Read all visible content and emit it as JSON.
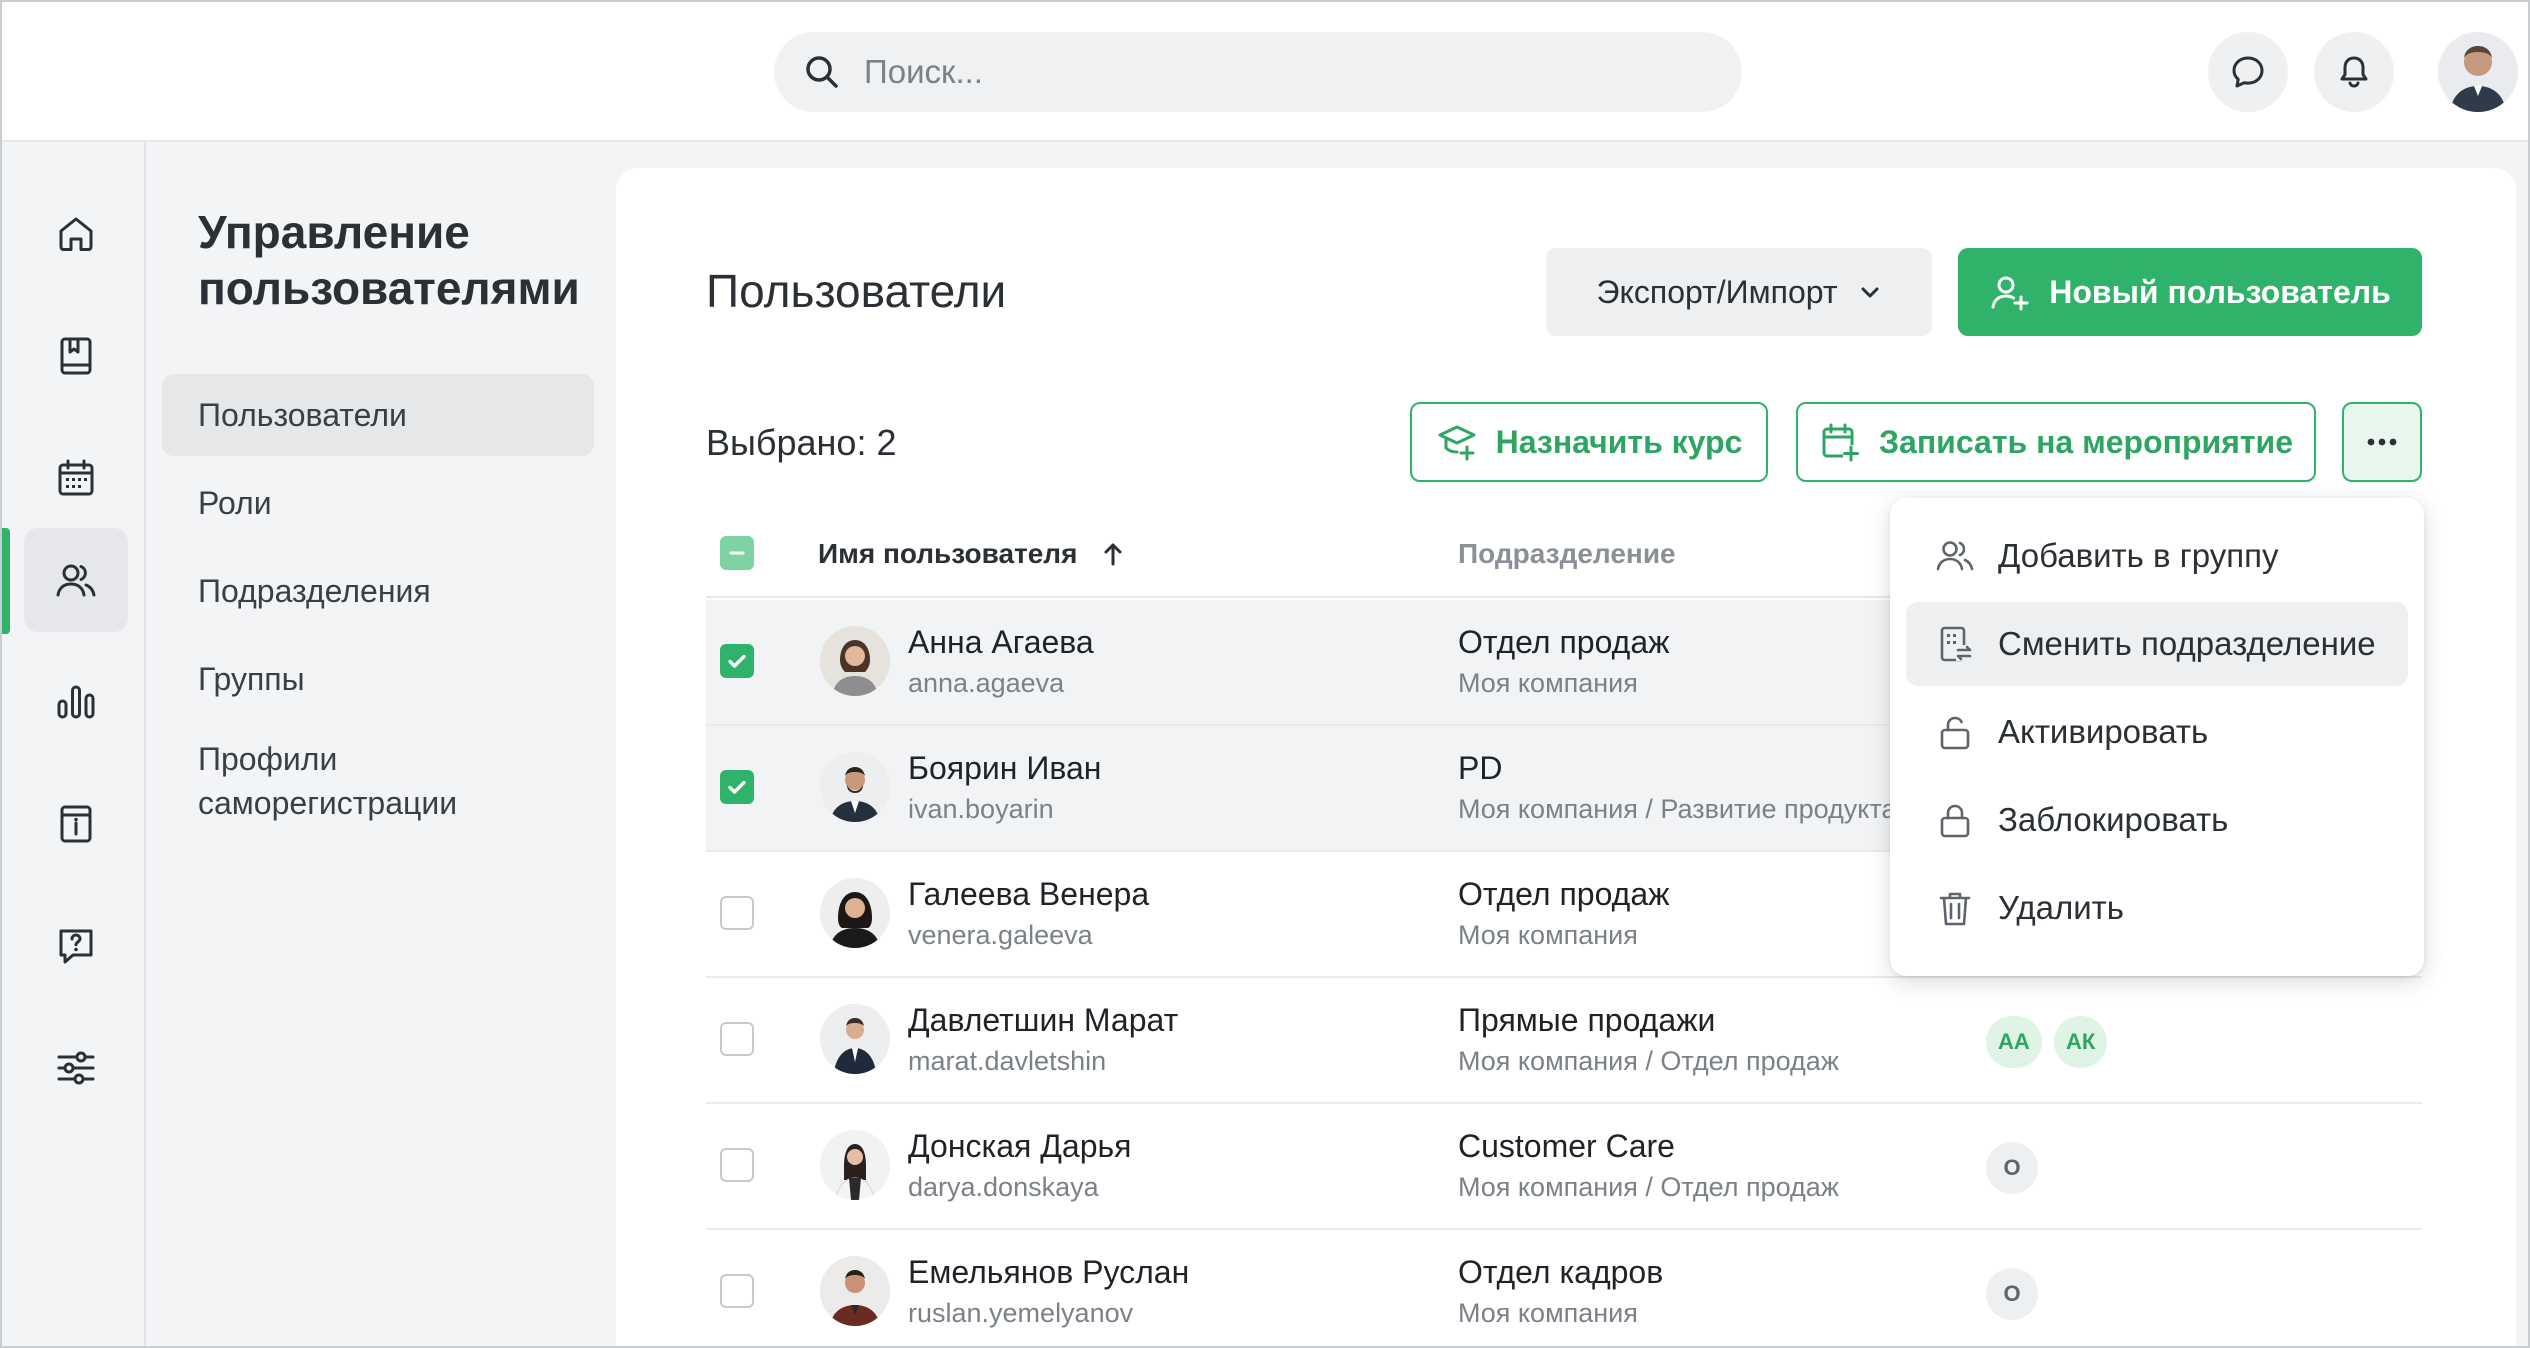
{
  "colors": {
    "accent": "#2fb36b",
    "accent_text": "#2fa564",
    "muted": "#7b8089"
  },
  "topbar": {
    "search_placeholder": "Поиск...",
    "icons": [
      "search-icon",
      "chat-icon",
      "bell-icon",
      "avatar"
    ]
  },
  "rail": {
    "items": [
      "home-icon",
      "book-icon",
      "calendar-icon",
      "users-icon",
      "chart-icon",
      "info-icon",
      "help-icon",
      "settings-sliders-icon"
    ],
    "active": "users-icon"
  },
  "subnav": {
    "title": "Управление пользователями",
    "items": [
      {
        "label": "Пользователи"
      },
      {
        "label": "Роли"
      },
      {
        "label": "Подразделения"
      },
      {
        "label": "Группы"
      },
      {
        "label": "Профили саморегистрации"
      }
    ]
  },
  "main": {
    "title": "Пользователи",
    "export_label": "Экспорт/Импорт",
    "new_user_label": "Новый пользователь",
    "selected_label": "Выбрано: 2",
    "assign_course_label": "Назначить курс",
    "enroll_event_label": "Записать на мероприятие"
  },
  "table": {
    "col_name": "Имя пользователя",
    "col_dept": "Подразделение",
    "rows": [
      {
        "name": "Анна Агаева",
        "login": "anna.agaeva",
        "dept": "Отдел продаж",
        "path": "Моя компания",
        "checked": true,
        "chips": []
      },
      {
        "name": "Боярин Иван",
        "login": "ivan.boyarin",
        "dept": "PD",
        "path": "Моя компания / Развитие продукта",
        "checked": true,
        "chips": []
      },
      {
        "name": "Галеева Венера",
        "login": "venera.galeeva",
        "dept": "Отдел продаж",
        "path": "Моя компания",
        "checked": false,
        "chips": []
      },
      {
        "name": "Давлетшин Марат",
        "login": "marat.davletshin",
        "dept": "Прямые продажи",
        "path": "Моя компания / Отдел продаж",
        "checked": false,
        "chips": [
          "АА",
          "АК"
        ]
      },
      {
        "name": "Донская Дарья",
        "login": "darya.donskaya",
        "dept": "Customer Care",
        "path": "Моя компания / Отдел продаж",
        "checked": false,
        "chips": [
          "О"
        ]
      },
      {
        "name": "Емельянов Руслан",
        "login": "ruslan.yemelyanov",
        "dept": "Отдел кадров",
        "path": "Моя компания",
        "checked": false,
        "chips": [
          "О"
        ]
      }
    ]
  },
  "menu": {
    "items": [
      {
        "label": "Добавить в группу",
        "icon": "users-add-icon"
      },
      {
        "label": "Сменить подразделение",
        "icon": "building-swap-icon"
      },
      {
        "label": "Активировать",
        "icon": "unlock-icon"
      },
      {
        "label": "Заблокировать",
        "icon": "lock-icon"
      },
      {
        "label": "Удалить",
        "icon": "trash-icon"
      }
    ]
  }
}
